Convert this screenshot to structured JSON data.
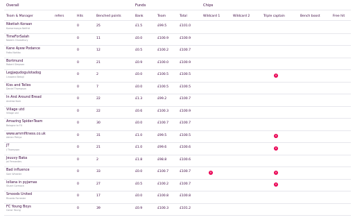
{
  "groups": {
    "overall": "Overall",
    "funds": "Funds",
    "chips": "Chips"
  },
  "columns": {
    "team_manager": "Team & Manager",
    "refers": "refers",
    "hits": "Hits",
    "benched": "Benched points",
    "bank": "Bank",
    "team": "Team",
    "total": "Total",
    "wildcard1": "Wildcard 1",
    "wildcard2": "Wildcard 2",
    "triple_captain": "Triple captain",
    "bench_boost": "Bench boost",
    "free_hit": "Free hit"
  },
  "chip_icon": "close-icon",
  "chip_color": "#e90052",
  "rows": [
    {
      "team": "Nketiah Koraan",
      "manager": "Kumarmonya Nelfrid",
      "hits": "0",
      "benched": "25",
      "bank": "£1.5",
      "team_value": "£99.5",
      "total": "£101.0",
      "chips": []
    },
    {
      "team": "TimeForSalah",
      "manager": "Naeem Chowdhury",
      "hits": "0",
      "benched": "11",
      "bank": "£0.0",
      "team_value": "£100.9",
      "total": "£100.9",
      "chips": []
    },
    {
      "team": "Kane Ayew Podance",
      "manager": "Faiko Nahiko",
      "hits": "0",
      "benched": "12",
      "bank": "£0.5",
      "team_value": "£100.2",
      "total": "£100.7",
      "chips": []
    },
    {
      "team": "Bortmund",
      "manager": "Robert Simpson",
      "hits": "0",
      "benched": "21",
      "bank": "£0.9",
      "team_value": "£100.0",
      "total": "£100.9",
      "chips": []
    },
    {
      "team": "Legjaqudogulotadog",
      "manager": "Linawani Bekoji",
      "hits": "0",
      "benched": "2",
      "bank": "£0.0",
      "team_value": "£100.5",
      "total": "£100.5",
      "chips": [
        "triple_captain"
      ]
    },
    {
      "team": "Kiss and Telles",
      "manager": "Daniel Thompson",
      "hits": "0",
      "benched": "7",
      "bank": "£0.0",
      "team_value": "£100.5",
      "total": "£100.5",
      "chips": []
    },
    {
      "team": "In And Around Bread",
      "manager": "Andrew Kock",
      "hits": "0",
      "benched": "22",
      "bank": "£1.3",
      "team_value": "£99.2",
      "total": "£100.7",
      "chips": []
    },
    {
      "team": "Village utd",
      "manager": "Village utd",
      "hits": "0",
      "benched": "22",
      "bank": "£0.6",
      "team_value": "£100.3",
      "total": "£100.9",
      "chips": []
    },
    {
      "team": "Amazing Spider-Team",
      "manager": "Bologna to FU",
      "hits": "0",
      "benched": "30",
      "bank": "£0.0",
      "team_value": "£100.7",
      "total": "£100.7",
      "chips": []
    },
    {
      "team": "www.amrnfitness.co.uk",
      "manager": "Adrian Petrya",
      "hits": "0",
      "benched": "31",
      "bank": "£1.0",
      "team_value": "£99.5",
      "total": "£100.5",
      "chips": [
        "triple_captain"
      ]
    },
    {
      "team": "JT",
      "manager": "J Thompson",
      "hits": "0",
      "benched": "21",
      "bank": "£1.0",
      "team_value": "£99.6",
      "total": "£100.6",
      "chips": [
        "triple_captain"
      ]
    },
    {
      "team": "Jeuuvy Baka",
      "manager": "Joi Fernandes",
      "hits": "0",
      "benched": "2",
      "bank": "£1.8",
      "team_value": "£98.8",
      "total": "£100.6",
      "chips": []
    },
    {
      "team": "Bad influence",
      "manager": "Sam Wheeler",
      "hits": "0",
      "benched": "33",
      "bank": "£0.0",
      "team_value": "£100.7",
      "total": "£100.7",
      "chips": [
        "wildcard1",
        "triple_captain"
      ]
    },
    {
      "team": "lollana in pyjamas",
      "manager": "Stuart Cormack",
      "hits": "0",
      "benched": "27",
      "bank": "£0.5",
      "team_value": "£100.2",
      "total": "£100.7",
      "chips": [
        "triple_captain"
      ]
    },
    {
      "team": "Smoods United",
      "manager": "Ricardo Forrester",
      "hits": "0",
      "benched": "17",
      "bank": "£0.0",
      "team_value": "£100.8",
      "total": "£100.8",
      "chips": []
    },
    {
      "team": "FC Young Boys",
      "manager": "Conor Young",
      "hits": "0",
      "benched": "39",
      "bank": "£0.9",
      "team_value": "£100.3",
      "total": "£101.2",
      "chips": []
    }
  ]
}
